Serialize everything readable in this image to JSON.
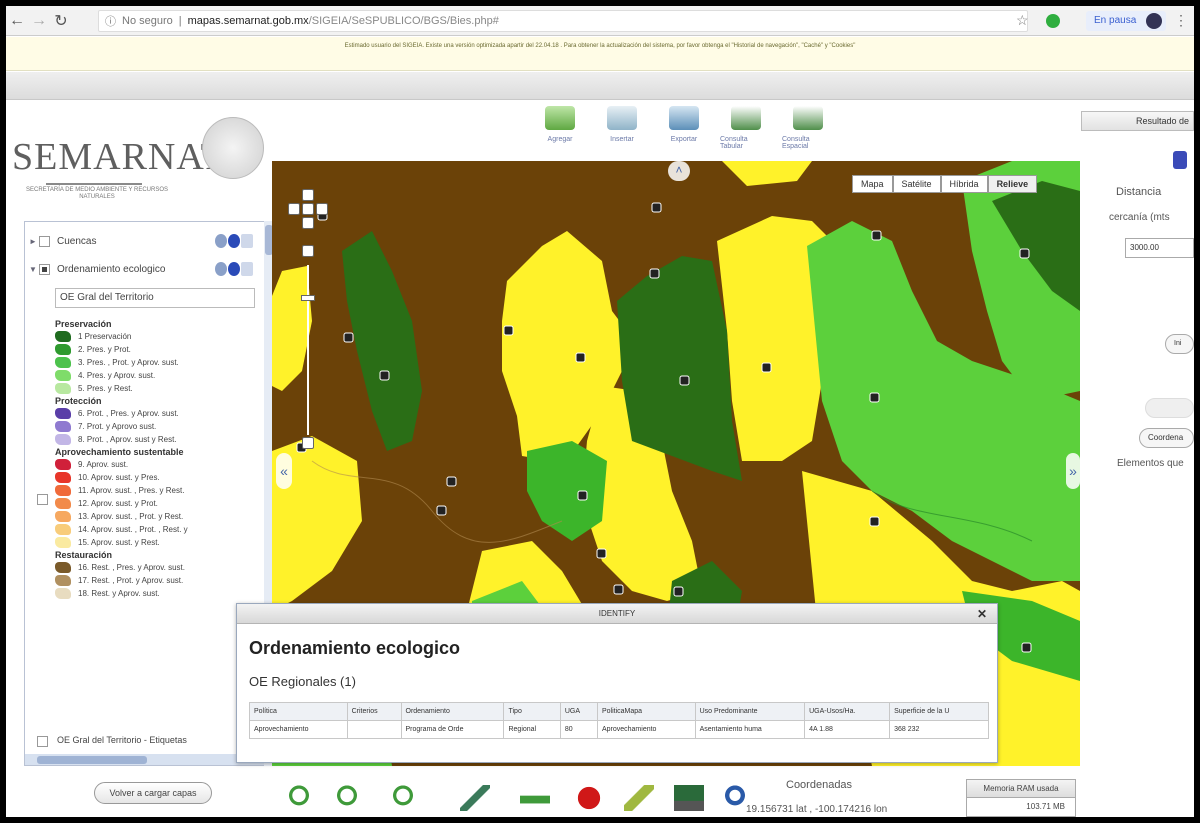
{
  "browser": {
    "security": "No seguro",
    "url_host": "mapas.semarnat.gob.mx",
    "url_path": "/SIGEIA/SeSPUBLICO/BGS/Bies.php#",
    "profile_label": "En pausa"
  },
  "notice": "Estimado usuario del SIGEIA. Existe una versión optimizada apartir del 22.04.18 . Para obtener la actualización del sistema, por favor obtenga el \"Historial de navegación\", \"Caché\" y \"Cookies\"",
  "header": {
    "logo": "SEMARNAT",
    "logo_sub": "SECRETARÍA DE MEDIO AMBIENTE Y RECURSOS NATURALES"
  },
  "top_tools": [
    {
      "label": "Agregar",
      "icon": "add-layer-icon",
      "color": "#5fa842"
    },
    {
      "label": "Insertar",
      "icon": "insert-icon",
      "color": "#8fb3c8"
    },
    {
      "label": "Exportar",
      "icon": "export-icon",
      "color": "#5c8fb8"
    },
    {
      "label": "Consulta Tabular",
      "icon": "table-query-icon",
      "color": "#4f8f4a"
    },
    {
      "label": "Consulta Espacial",
      "icon": "spatial-query-icon",
      "color": "#4f8f4a"
    }
  ],
  "layers": {
    "rows": [
      {
        "label": "Cuencas",
        "checked": false
      },
      {
        "label": "Ordenamiento ecologico",
        "checked": true
      }
    ],
    "selected": "OE Gral del Territorio",
    "legend": [
      {
        "heading": "Preservación",
        "items": [
          {
            "label": "1 Preservación",
            "color": "#1f6b1f"
          },
          {
            "label": "2. Pres. y Prot.",
            "color": "#2f9a2f"
          },
          {
            "label": "3. Pres. , Prot. y Aprov. sust.",
            "color": "#4cc24c"
          },
          {
            "label": "4. Pres. y Aprov. sust.",
            "color": "#7fdc6a"
          },
          {
            "label": "5. Pres. y Rest.",
            "color": "#b8e8a0"
          }
        ]
      },
      {
        "heading": "Protección",
        "items": [
          {
            "label": "6. Prot. , Pres. y Aprov. sust.",
            "color": "#5a3ea8"
          },
          {
            "label": "7. Prot. y Aprovo sust.",
            "color": "#8f7ad0"
          },
          {
            "label": "8. Prot. , Aprov. sust y Rest.",
            "color": "#c2b6e6"
          }
        ]
      },
      {
        "heading": "Aprovechamiento sustentable",
        "items": [
          {
            "label": "9. Aprov. sust.",
            "color": "#d0203a"
          },
          {
            "label": "10. Aprov. sust. y Pres.",
            "color": "#e8362a"
          },
          {
            "label": "11. Aprov. sust. , Pres. y Rest.",
            "color": "#f06a3a"
          },
          {
            "label": "12. Aprov. sust. y Prot.",
            "color": "#f28a4a"
          },
          {
            "label": "13. Aprov. sust. , Prot. y Rest.",
            "color": "#f6a860"
          },
          {
            "label": "14. Aprov. sust. , Prot. , Rest. y",
            "color": "#f8cc7a"
          },
          {
            "label": "15. Aprov. sust. y Rest.",
            "color": "#faeaa0"
          }
        ]
      },
      {
        "heading": "Restauración",
        "items": [
          {
            "label": "16. Rest. , Pres. y Aprov. sust.",
            "color": "#7a5a2a"
          },
          {
            "label": "17. Rest. , Prot. y Aprov. sust.",
            "color": "#b09060"
          },
          {
            "label": "18. Rest. y Aprov. sust.",
            "color": "#e8dcc0"
          }
        ]
      }
    ],
    "etiquetas_label": "OE Gral del Territorio - Etiquetas",
    "reload_label": "Volver a cargar capas"
  },
  "map": {
    "types": [
      "Mapa",
      "Satélite",
      "Híbrida",
      "Relieve"
    ],
    "active_type": "Relieve",
    "colors": {
      "brown": "#6b4208",
      "yellow": "#fff22a",
      "light_green": "#5cd03c",
      "dark_green": "#2a6e16",
      "mid_green": "#3cb52a"
    }
  },
  "identify": {
    "title": "IDENTIFY",
    "heading": "Ordenamiento ecologico",
    "subheading": "OE Regionales (1)",
    "columns": [
      "Política",
      "Criterios",
      "Ordenamiento",
      "Tipo",
      "UGA",
      "PoliticaMapa",
      "Uso Predominante",
      "UGA-Usos/Ha.",
      "Superficie de la U"
    ],
    "rows": [
      [
        "Aprovechamiento",
        "",
        "Programa de Orde",
        "Regional",
        "80",
        "Aprovechamiento",
        "Asentamiento huma",
        "4A 1.88",
        "368 232"
      ]
    ]
  },
  "right_panel": {
    "tab": "Resultado de",
    "distance_label": "Distancia",
    "cercania_label": "cercanía (mts",
    "distance_value": "3000.00",
    "btn1": "Ini",
    "btn3": "Coordena",
    "elementos": "Elementos que"
  },
  "bottom": {
    "tools": [
      {
        "icon": "zoom-in-icon",
        "color": "#3f9a3a"
      },
      {
        "icon": "zoom-out-icon",
        "color": "#3f9a3a"
      },
      {
        "icon": "zoom-extent-icon",
        "color": "#3f9a3a"
      },
      {
        "icon": "pan-icon",
        "color": "#3a7a5a"
      },
      {
        "icon": "measure-icon",
        "color": "#3f9a3a"
      },
      {
        "icon": "identify-icon",
        "color": "#d01818"
      },
      {
        "icon": "draw-icon",
        "color": "#a0b840"
      },
      {
        "icon": "print-icon",
        "color": "#2a6a3a"
      },
      {
        "icon": "info-icon",
        "color": "#2a5aa8"
      }
    ],
    "coords_label": "Coordenadas",
    "coords_value": "19.156731 lat , -100.174216 lon",
    "ram_label": "Memoria RAM usada",
    "ram_value": "103.71 MB"
  }
}
